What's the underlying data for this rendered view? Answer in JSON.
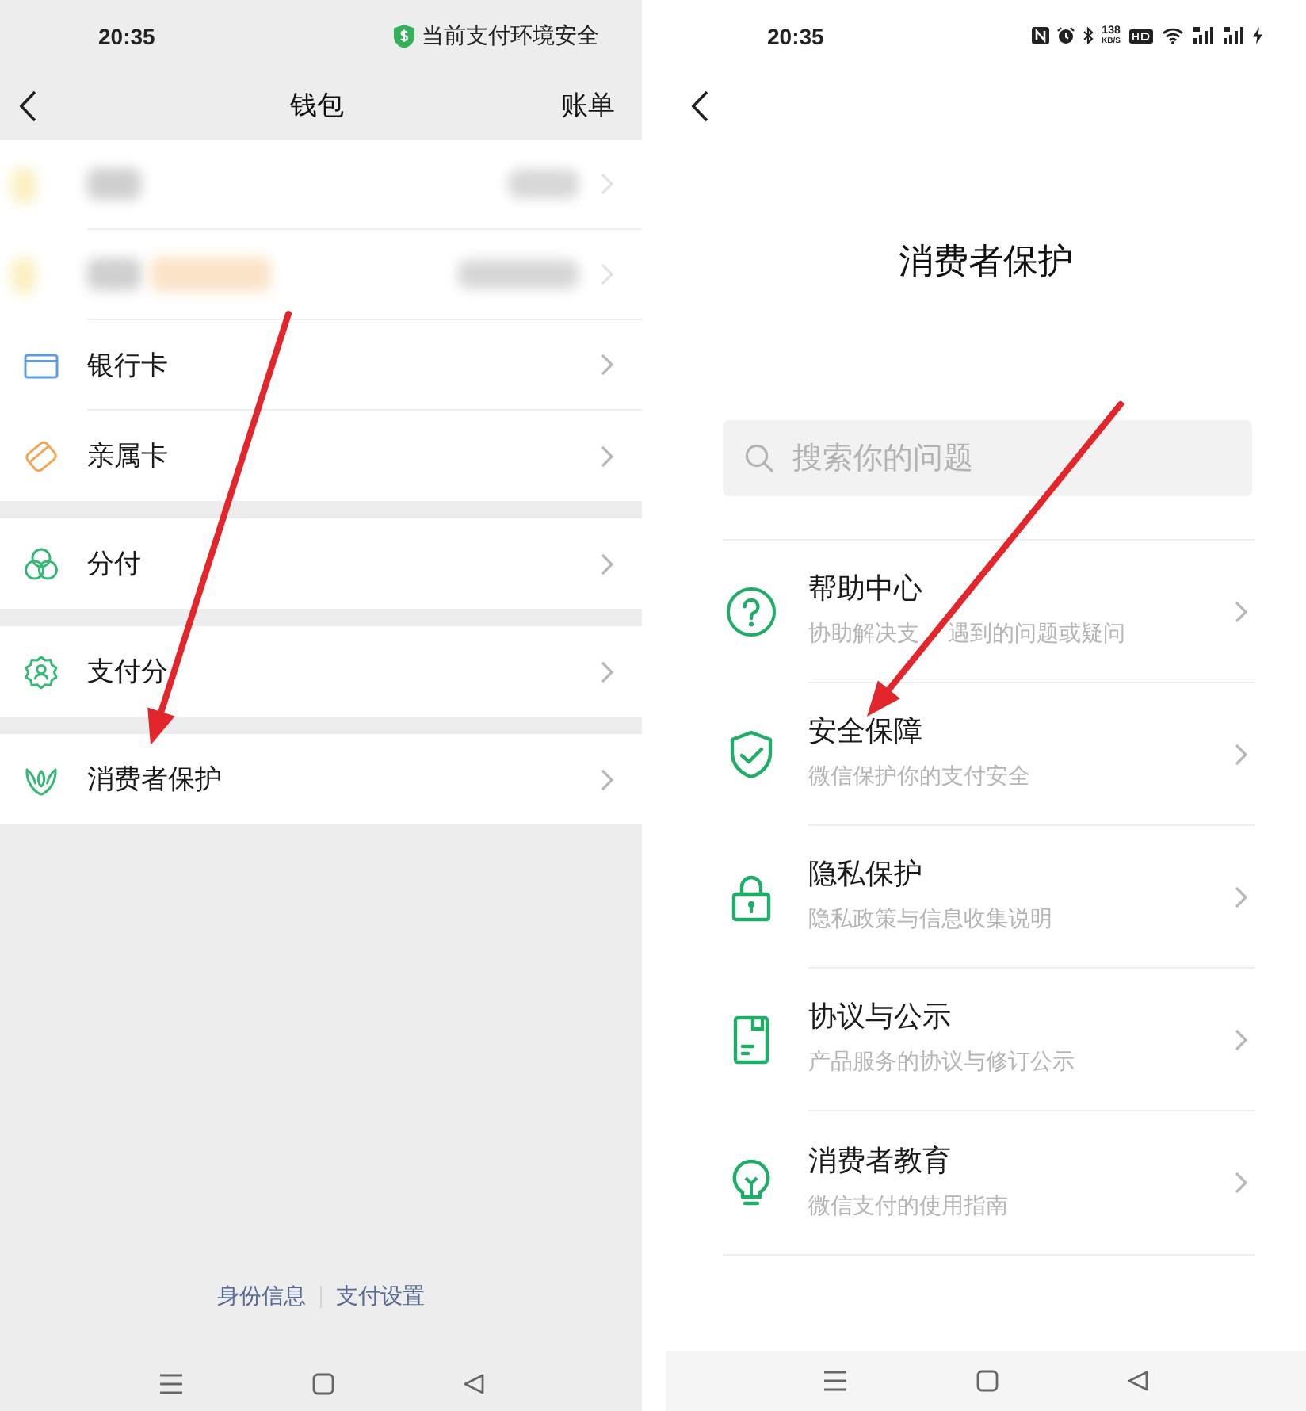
{
  "wallet_screen": {
    "status_bar": {
      "time": "20:35",
      "security_notice": "当前支付环境安全"
    },
    "nav_bar": {
      "title": "钱包",
      "action": "账单"
    },
    "sections": [
      {
        "items": [
          {
            "kind": "redacted"
          },
          {
            "kind": "redacted"
          },
          {
            "kind": "entry",
            "label": "银行卡"
          },
          {
            "kind": "entry",
            "label": "亲属卡"
          }
        ]
      },
      {
        "items": [
          {
            "kind": "entry",
            "label": "分付"
          }
        ]
      },
      {
        "items": [
          {
            "kind": "entry",
            "label": "支付分"
          }
        ]
      },
      {
        "items": [
          {
            "kind": "entry",
            "label": "消费者保护"
          }
        ]
      }
    ],
    "footer_links": [
      "身份信息",
      "支付设置"
    ]
  },
  "consumer_protection_screen": {
    "status_bar": {
      "time": "20:35",
      "net_speed": "138",
      "net_speed_unit": "KB/S"
    },
    "title": "消费者保护",
    "search": {
      "placeholder": "搜索你的问题"
    },
    "items": [
      {
        "title": "帮助中心",
        "subtitle_parts": [
          "协助解决支",
          "遇到的问题或疑问"
        ]
      },
      {
        "title": "安全保障",
        "subtitle": "微信保护你的支付安全"
      },
      {
        "title": "隐私保护",
        "subtitle": "隐私政策与信息收集说明"
      },
      {
        "title": "协议与公示",
        "subtitle": "产品服务的协议与修订公示"
      },
      {
        "title": "消费者教育",
        "subtitle": "微信支付的使用指南"
      }
    ]
  }
}
